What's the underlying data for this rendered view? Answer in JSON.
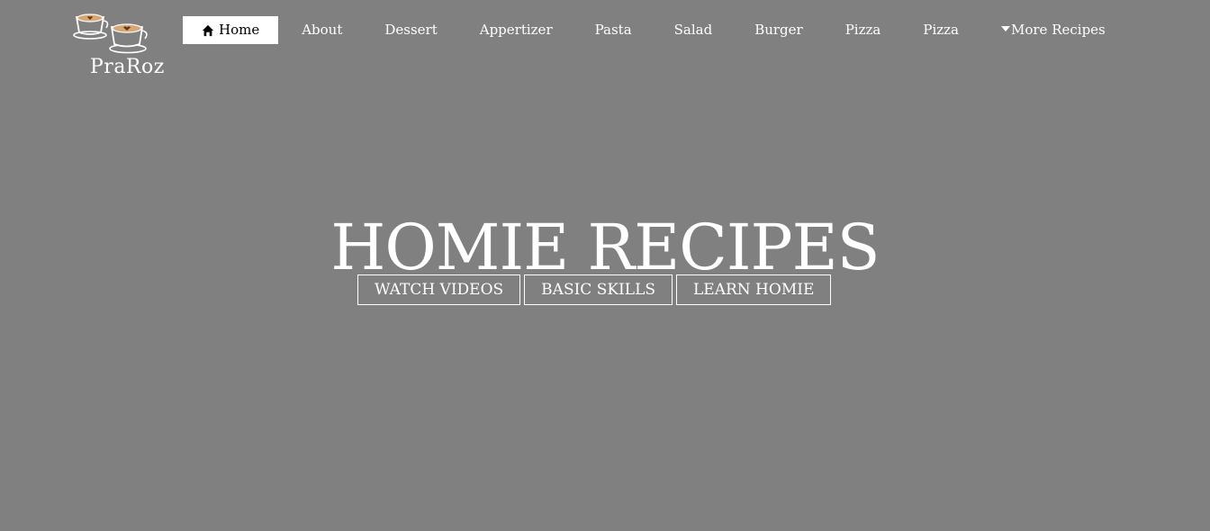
{
  "brand": {
    "name": "PraRoz",
    "icon": "coffee-cups-logo"
  },
  "nav": {
    "items": [
      {
        "label": "Home",
        "icon": "home-icon",
        "active": true
      },
      {
        "label": "About"
      },
      {
        "label": "Dessert"
      },
      {
        "label": "Appertizer"
      },
      {
        "label": "Pasta"
      },
      {
        "label": "Salad"
      },
      {
        "label": "Burger"
      },
      {
        "label": "Pizza"
      },
      {
        "label": "Pizza"
      },
      {
        "label": "More Recipes",
        "icon": "caret-down-icon"
      }
    ]
  },
  "hero": {
    "title": "HOMIE RECIPES",
    "buttons": [
      {
        "label": "WATCH VIDEOS"
      },
      {
        "label": "BASIC SKILLS"
      },
      {
        "label": "LEARN HOMIE"
      }
    ]
  },
  "colors": {
    "background": "#808080",
    "text": "#ffffff",
    "active_nav_bg": "#ffffff",
    "active_nav_text": "#000000",
    "latte": "#d9a774"
  }
}
